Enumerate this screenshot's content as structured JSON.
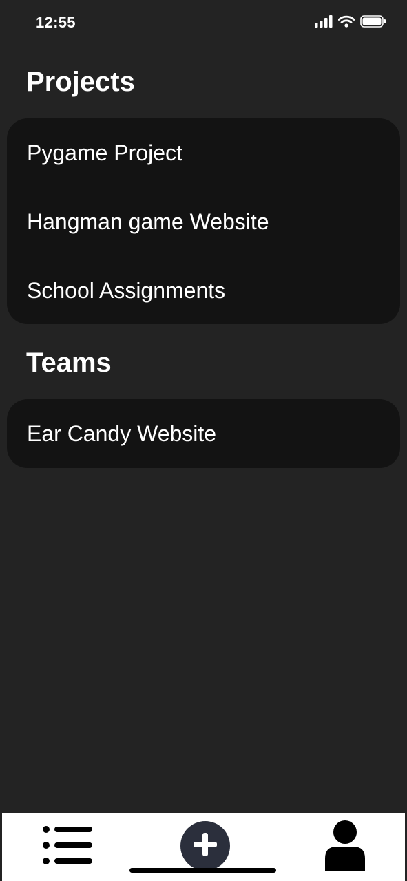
{
  "status_bar": {
    "time": "12:55",
    "icons": [
      "signal-icon",
      "wifi-icon",
      "battery-icon"
    ]
  },
  "projects": {
    "title": "Projects",
    "items": [
      {
        "label": "Pygame Project"
      },
      {
        "label": "Hangman game Website"
      },
      {
        "label": "School Assignments"
      }
    ]
  },
  "teams": {
    "title": "Teams",
    "items": [
      {
        "label": "Ear Candy Website"
      }
    ]
  },
  "bottom_nav": {
    "items": [
      {
        "icon": "list-icon"
      },
      {
        "icon": "plus-icon"
      },
      {
        "icon": "user-icon"
      }
    ]
  },
  "colors": {
    "background": "#232323",
    "card": "#131313",
    "text": "#ffffff",
    "tab_bar": "#ffffff",
    "add_button": "#2b2f3c"
  }
}
